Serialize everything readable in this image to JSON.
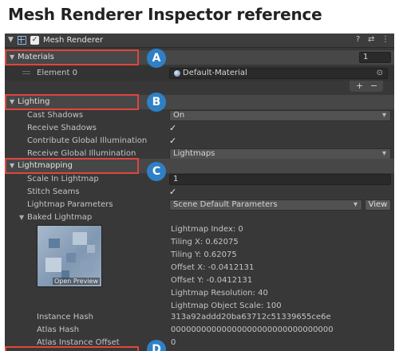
{
  "page_title": "Mesh Renderer Inspector reference",
  "component": {
    "title": "Mesh Renderer",
    "enabled_mark": "✓",
    "header_icons": [
      "?",
      "⇄",
      "⋮"
    ]
  },
  "materials": {
    "title": "Materials",
    "count": "1",
    "element_label": "Element 0",
    "element_value": "Default-Material",
    "add_label": "+",
    "remove_label": "−"
  },
  "lighting": {
    "title": "Lighting",
    "cast_shadows_label": "Cast Shadows",
    "cast_shadows_value": "On",
    "receive_shadows_label": "Receive Shadows",
    "contribute_gi_label": "Contribute Global Illumination",
    "receive_gi_label": "Receive Global Illumination",
    "receive_gi_value": "Lightmaps",
    "check_mark": "✓"
  },
  "lightmapping": {
    "title": "Lightmapping",
    "scale_label": "Scale In Lightmap",
    "scale_value": "1",
    "stitch_label": "Stitch Seams",
    "params_label": "Lightmap Parameters",
    "params_value": "Scene Default Parameters",
    "view_label": "View",
    "baked_label": "Baked Lightmap",
    "open_preview_label": "Open Preview",
    "info": [
      "Lightmap Index: 0",
      "Tiling X: 0.62075",
      "Tiling Y: 0.62075",
      "Offset X: -0.0412131",
      "Offset Y: -0.0412131",
      "Lightmap Resolution: 40",
      "Lightmap Object Scale: 100"
    ],
    "instance_hash_label": "Instance Hash",
    "instance_hash_value": "313a92addd20ba63712c51339655ce6e",
    "atlas_hash_label": "Atlas Hash",
    "atlas_hash_value": "00000000000000000000000000000000",
    "atlas_offset_label": "Atlas Instance Offset",
    "atlas_offset_value": "0"
  },
  "callouts": [
    "A",
    "B",
    "C",
    "D"
  ],
  "colors": {
    "callout_badge": "#2f80c6",
    "highlight_box": "#e0463c",
    "inspector_bg": "#383838",
    "section_bar": "#474747"
  }
}
